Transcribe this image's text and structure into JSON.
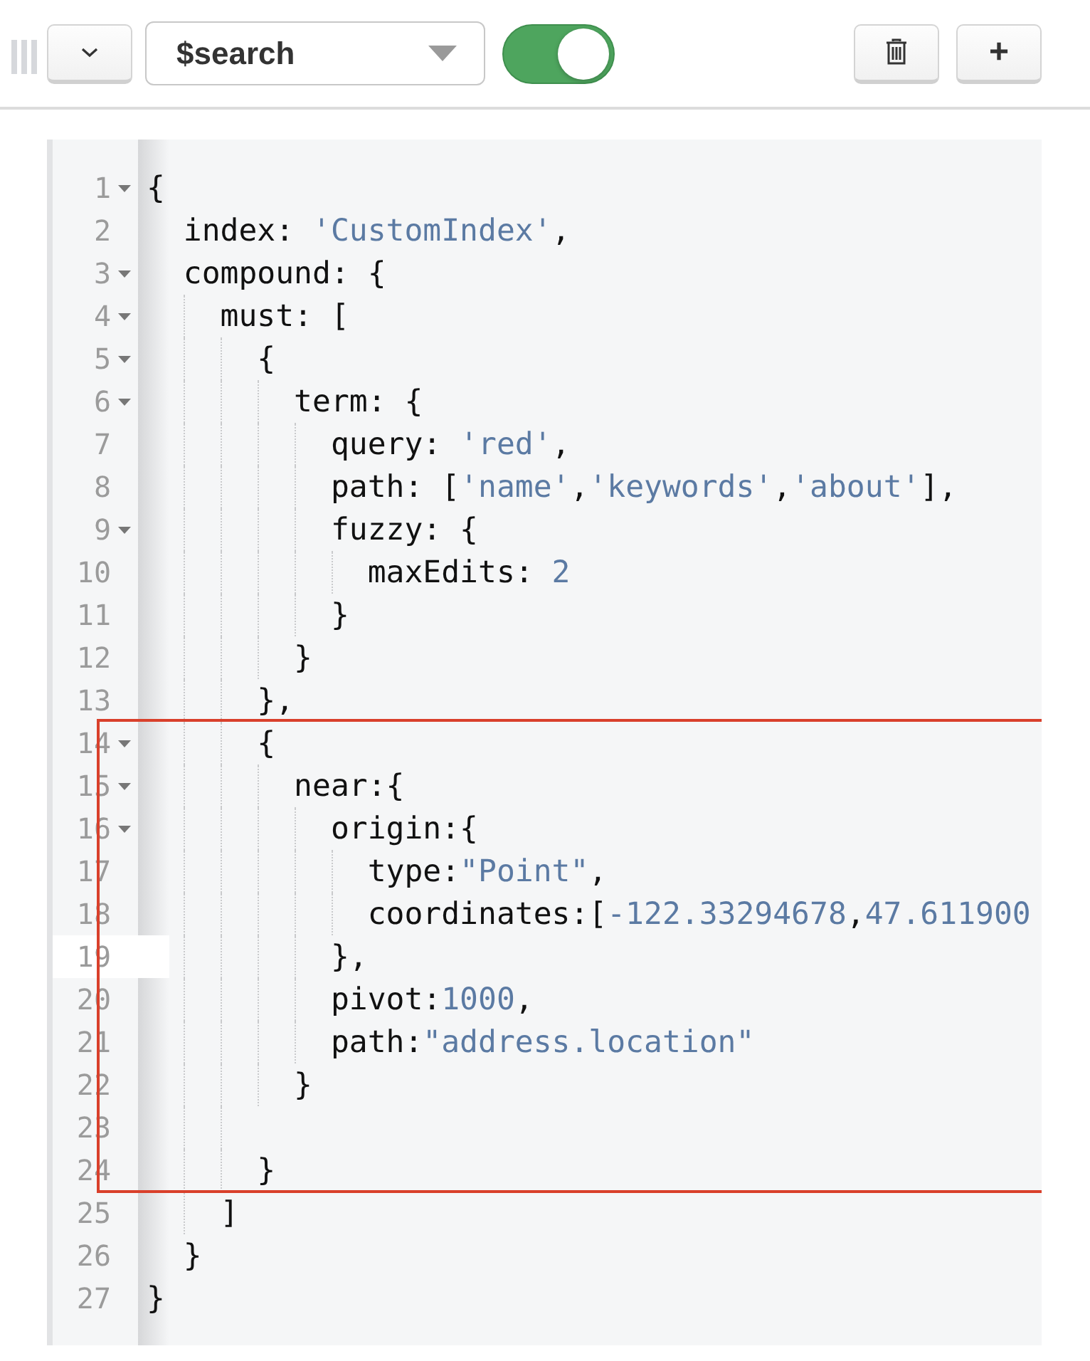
{
  "toolbar": {
    "stage": {
      "value": "$search"
    },
    "toggle": {
      "on": true
    },
    "add_button": {
      "label": "+"
    }
  },
  "editor": {
    "blocks": [
      {
        "highlighted": false,
        "lines": [
          {
            "number": "1",
            "foldable": true,
            "active": false,
            "parts": [
              {
                "text": "{",
                "kind": "plain"
              }
            ]
          },
          {
            "number": "2",
            "foldable": false,
            "active": false,
            "parts": [
              {
                "text": "  index: ",
                "kind": "plain"
              },
              {
                "text": "'CustomIndex'",
                "kind": "value"
              },
              {
                "text": ",",
                "kind": "plain"
              }
            ]
          },
          {
            "number": "3",
            "foldable": true,
            "active": false,
            "parts": [
              {
                "text": "  compound: {",
                "kind": "plain"
              }
            ]
          },
          {
            "number": "4",
            "foldable": true,
            "active": false,
            "parts": [
              {
                "text": "    must: [",
                "kind": "plain"
              }
            ]
          },
          {
            "number": "5",
            "foldable": true,
            "active": false,
            "parts": [
              {
                "text": "      {",
                "kind": "plain"
              }
            ]
          },
          {
            "number": "6",
            "foldable": true,
            "active": false,
            "parts": [
              {
                "text": "        term: {",
                "kind": "plain"
              }
            ]
          },
          {
            "number": "7",
            "foldable": false,
            "active": false,
            "parts": [
              {
                "text": "          query: ",
                "kind": "plain"
              },
              {
                "text": "'red'",
                "kind": "value"
              },
              {
                "text": ",",
                "kind": "plain"
              }
            ]
          },
          {
            "number": "8",
            "foldable": false,
            "active": false,
            "parts": [
              {
                "text": "          path: [",
                "kind": "plain"
              },
              {
                "text": "'name'",
                "kind": "value"
              },
              {
                "text": ",",
                "kind": "plain"
              },
              {
                "text": "'keywords'",
                "kind": "value"
              },
              {
                "text": ",",
                "kind": "plain"
              },
              {
                "text": "'about'",
                "kind": "value"
              },
              {
                "text": "],",
                "kind": "plain"
              }
            ]
          },
          {
            "number": "9",
            "foldable": true,
            "active": false,
            "parts": [
              {
                "text": "          fuzzy: {",
                "kind": "plain"
              }
            ]
          },
          {
            "number": "10",
            "foldable": false,
            "active": false,
            "parts": [
              {
                "text": "            maxEdits: ",
                "kind": "plain"
              },
              {
                "text": "2",
                "kind": "value"
              }
            ]
          },
          {
            "number": "11",
            "foldable": false,
            "active": false,
            "parts": [
              {
                "text": "          }",
                "kind": "plain"
              }
            ]
          },
          {
            "number": "12",
            "foldable": false,
            "active": false,
            "parts": [
              {
                "text": "        }",
                "kind": "plain"
              }
            ]
          },
          {
            "number": "13",
            "foldable": false,
            "active": false,
            "parts": [
              {
                "text": "      },",
                "kind": "plain"
              }
            ]
          }
        ]
      },
      {
        "highlighted": true,
        "lines": [
          {
            "number": "14",
            "foldable": true,
            "active": false,
            "parts": [
              {
                "text": "      {",
                "kind": "plain"
              }
            ]
          },
          {
            "number": "15",
            "foldable": true,
            "active": false,
            "parts": [
              {
                "text": "        near:{",
                "kind": "plain"
              }
            ]
          },
          {
            "number": "16",
            "foldable": true,
            "active": false,
            "parts": [
              {
                "text": "          origin:{",
                "kind": "plain"
              }
            ]
          },
          {
            "number": "17",
            "foldable": false,
            "active": false,
            "parts": [
              {
                "text": "            type:",
                "kind": "plain"
              },
              {
                "text": "\"Point\"",
                "kind": "value"
              },
              {
                "text": ",",
                "kind": "plain"
              }
            ]
          },
          {
            "number": "18",
            "foldable": false,
            "active": false,
            "parts": [
              {
                "text": "            coordinates:[",
                "kind": "plain"
              },
              {
                "text": "-122.33294678",
                "kind": "value"
              },
              {
                "text": ",",
                "kind": "plain"
              },
              {
                "text": "47.611900",
                "kind": "value"
              }
            ]
          },
          {
            "number": "19",
            "foldable": false,
            "active": true,
            "parts": [
              {
                "text": "          },",
                "kind": "plain"
              }
            ]
          },
          {
            "number": "20",
            "foldable": false,
            "active": false,
            "parts": [
              {
                "text": "          pivot:",
                "kind": "plain"
              },
              {
                "text": "1000",
                "kind": "value"
              },
              {
                "text": ",",
                "kind": "plain"
              }
            ]
          },
          {
            "number": "21",
            "foldable": false,
            "active": false,
            "parts": [
              {
                "text": "          path:",
                "kind": "plain"
              },
              {
                "text": "\"address.location\"",
                "kind": "value"
              }
            ]
          },
          {
            "number": "22",
            "foldable": false,
            "active": false,
            "parts": [
              {
                "text": "        }",
                "kind": "plain"
              }
            ]
          },
          {
            "number": "23",
            "foldable": false,
            "active": false
          },
          {
            "number": "24",
            "foldable": false,
            "active": false,
            "parts": [
              {
                "text": "      }",
                "kind": "plain"
              }
            ]
          }
        ]
      },
      {
        "highlighted": false,
        "lines": [
          {
            "number": "25",
            "foldable": false,
            "active": false,
            "parts": [
              {
                "text": "    ]",
                "kind": "plain"
              }
            ]
          },
          {
            "number": "26",
            "foldable": false,
            "active": false,
            "parts": [
              {
                "text": "  }",
                "kind": "plain"
              }
            ]
          },
          {
            "number": "27",
            "foldable": false,
            "active": false,
            "parts": [
              {
                "text": "}",
                "kind": "plain"
              }
            ]
          }
        ]
      }
    ]
  }
}
